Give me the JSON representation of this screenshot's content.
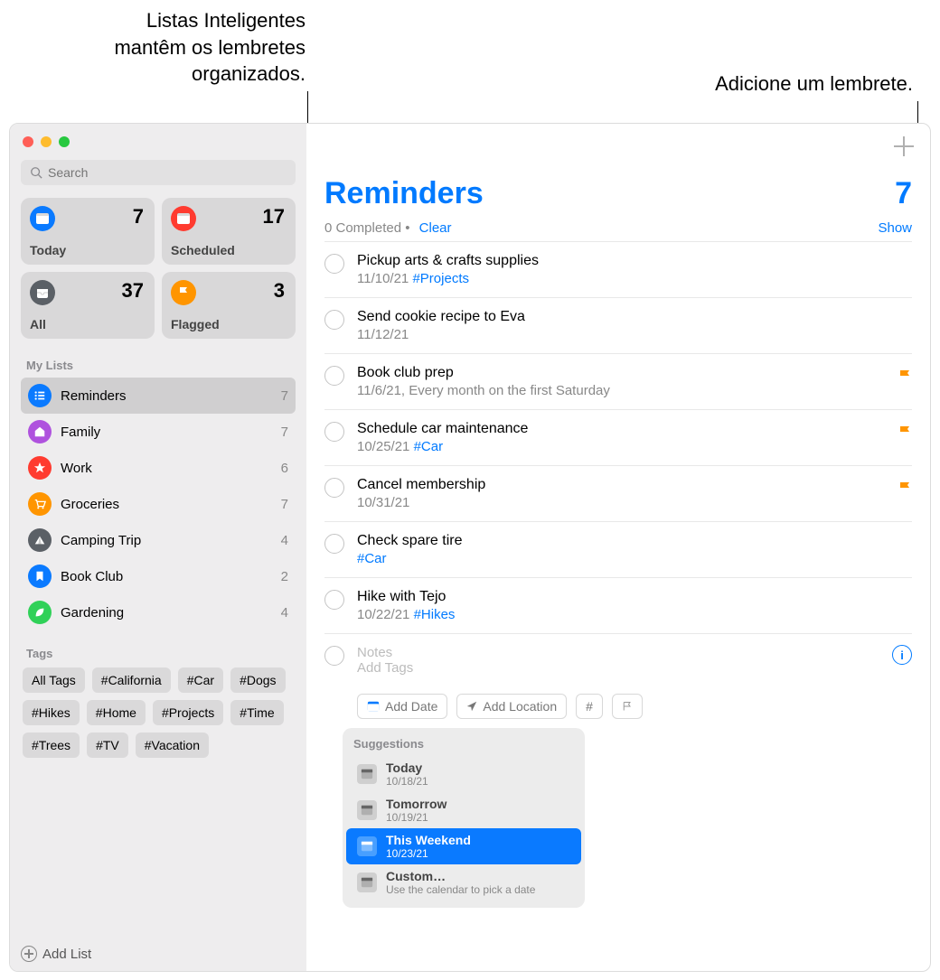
{
  "callouts": {
    "left_l1": "Listas Inteligentes",
    "left_l2": "mantêm os lembretes",
    "left_l3": "organizados.",
    "right": "Adicione um lembrete."
  },
  "search": {
    "placeholder": "Search"
  },
  "smart_lists": [
    {
      "label": "Today",
      "count": "7",
      "bg": "#0a7aff",
      "icon": "calendar"
    },
    {
      "label": "Scheduled",
      "count": "17",
      "bg": "#ff3b30",
      "icon": "calendar"
    },
    {
      "label": "All",
      "count": "37",
      "bg": "#5b6066",
      "icon": "tray"
    },
    {
      "label": "Flagged",
      "count": "3",
      "bg": "#ff9500",
      "icon": "flag"
    }
  ],
  "my_lists_header": "My Lists",
  "my_lists": [
    {
      "name": "Reminders",
      "count": "7",
      "color": "#0a7aff",
      "selected": true,
      "icon": "list"
    },
    {
      "name": "Family",
      "count": "7",
      "color": "#af52de",
      "selected": false,
      "icon": "home"
    },
    {
      "name": "Work",
      "count": "6",
      "color": "#ff3b30",
      "selected": false,
      "icon": "star"
    },
    {
      "name": "Groceries",
      "count": "7",
      "color": "#ff9500",
      "selected": false,
      "icon": "cart"
    },
    {
      "name": "Camping Trip",
      "count": "4",
      "color": "#5b6066",
      "selected": false,
      "icon": "tent"
    },
    {
      "name": "Book Club",
      "count": "2",
      "color": "#0a7aff",
      "selected": false,
      "icon": "bookmark"
    },
    {
      "name": "Gardening",
      "count": "4",
      "color": "#30d158",
      "selected": false,
      "icon": "leaf"
    }
  ],
  "tags_header": "Tags",
  "tags": [
    "All Tags",
    "#California",
    "#Car",
    "#Dogs",
    "#Hikes",
    "#Home",
    "#Projects",
    "#Time",
    "#Trees",
    "#TV",
    "#Vacation"
  ],
  "add_list_label": "Add List",
  "main": {
    "title": "Reminders",
    "count": "7",
    "completed": "0 Completed",
    "clear": "Clear",
    "show": "Show"
  },
  "reminders": [
    {
      "title": "Pickup arts & crafts supplies",
      "date": "11/10/21",
      "tag": "#Projects",
      "flag": false
    },
    {
      "title": "Send cookie recipe to Eva",
      "date": "11/12/21",
      "tag": "",
      "flag": false
    },
    {
      "title": "Book club prep",
      "date": "11/6/21, Every month on the first Saturday",
      "tag": "",
      "flag": true
    },
    {
      "title": "Schedule car maintenance",
      "date": "10/25/21",
      "tag": "#Car",
      "flag": true
    },
    {
      "title": "Cancel membership",
      "date": "10/31/21",
      "tag": "",
      "flag": true
    },
    {
      "title": "Check spare tire",
      "date": "",
      "tag": "#Car",
      "flag": false
    },
    {
      "title": "Hike with Tejo",
      "date": "10/22/21",
      "tag": "#Hikes",
      "flag": false
    }
  ],
  "new_rem": {
    "notes": "Notes",
    "addtags": "Add Tags",
    "adddate": "Add Date",
    "addloc": "Add Location"
  },
  "suggestions_header": "Suggestions",
  "suggestions": [
    {
      "label": "Today",
      "sub": "10/18/21",
      "selected": false
    },
    {
      "label": "Tomorrow",
      "sub": "10/19/21",
      "selected": false
    },
    {
      "label": "This Weekend",
      "sub": "10/23/21",
      "selected": true
    },
    {
      "label": "Custom…",
      "sub": "Use the calendar to pick a date",
      "selected": false
    }
  ]
}
